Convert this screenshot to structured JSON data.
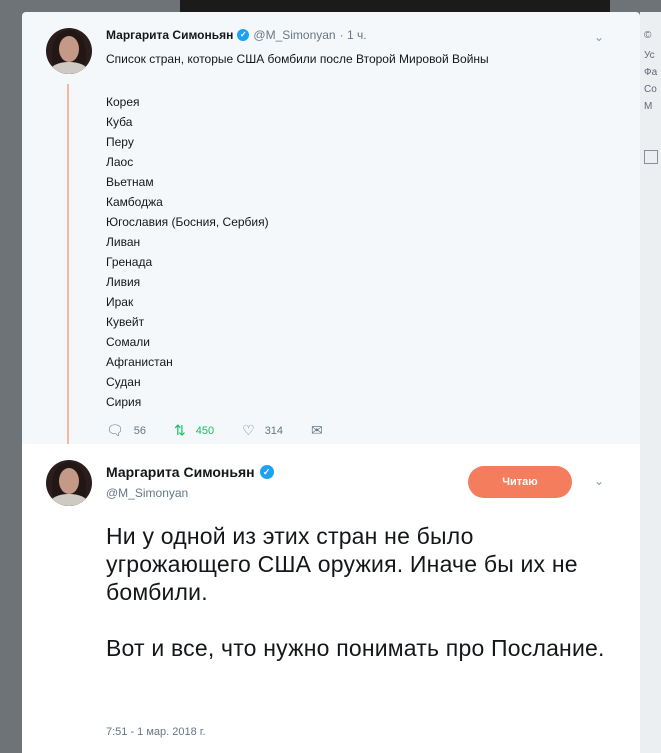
{
  "tweet1": {
    "name": "Маргарита Симоньян",
    "handle": "@M_Simonyan",
    "time": "· 1 ч.",
    "text": "Список стран, которые США бомбили после Второй Мировой Войны",
    "countries": [
      "Корея",
      "Куба",
      "Перу",
      "Лаос",
      "Вьетнам",
      "Камбоджа",
      "Югославия (Босния, Сербия)",
      "Ливан",
      "Гренада",
      "Ливия",
      "Ирак",
      "Кувейт",
      "Сомали",
      "Афганистан",
      "Судан",
      "Сирия"
    ],
    "replies": "56",
    "retweets": "450",
    "likes": "314"
  },
  "tweet2": {
    "name": "Маргарита Симоньян",
    "handle": "@M_Simonyan",
    "follow_label": "Читаю",
    "paragraph1": "Ни у одной из этих стран не было угрожающего США оружия. Иначе бы их не бомбили.",
    "paragraph2": "Вот и все, что нужно понимать про Послание.",
    "timestamp": "7:51 - 1 мар. 2018 г."
  },
  "sidebar_fragments": [
    "©",
    "Ус",
    "Фа",
    "Со",
    "М"
  ],
  "icons": {
    "reply": "reply-icon",
    "retweet": "retweet-icon",
    "like": "heart-icon",
    "dm": "envelope-icon",
    "verified": "verified-badge-icon",
    "chevron": "chevron-down-icon"
  },
  "colors": {
    "verified": "#1da1f2",
    "follow_button": "#f37d5c",
    "retweet": "#17bf63",
    "thread_line": "#f4b8a0"
  }
}
